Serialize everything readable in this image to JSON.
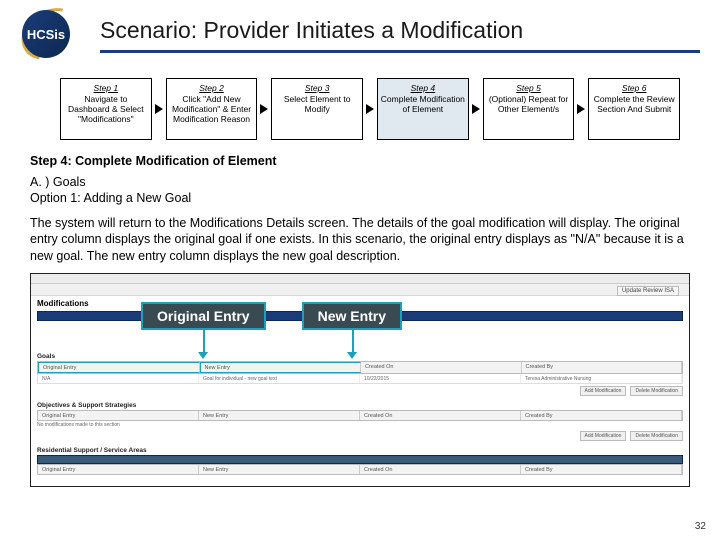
{
  "header": {
    "logo_text": "HCSis",
    "title": "Scenario: Provider Initiates a Modification"
  },
  "steps": [
    {
      "title": "Step 1",
      "text": "Navigate to Dashboard & Select \"Modifications\"",
      "active": false
    },
    {
      "title": "Step 2",
      "text": "Click \"Add New Modification\" & Enter Modification Reason",
      "active": false
    },
    {
      "title": "Step 3",
      "text": "Select Element to Modify",
      "active": false
    },
    {
      "title": "Step 4",
      "text": "Complete Modification of Element",
      "active": true
    },
    {
      "title": "Step 5",
      "text": "(Optional) Repeat for Other Element/s",
      "active": false
    },
    {
      "title": "Step 6",
      "text": "Complete the Review Section And Submit",
      "active": false
    }
  ],
  "content": {
    "emph": "Step 4: Complete Modification of Element",
    "section": "A. ) Goals",
    "option": "Option 1: Adding a New Goal",
    "paragraph": "The system will return to the Modifications Details screen. The details of the goal modification will display. The original entry column displays the original goal if one exists. In this scenario, the original entry displays as \"N/A\" because it is a new goal. The new entry column displays the new goal description."
  },
  "screenshot": {
    "heading": "Modifications",
    "callout1": "Original Entry",
    "callout2": "New Entry",
    "gridhead": {
      "c1": "Original Entry",
      "c2": "New Entry",
      "c3": "Created On",
      "c4": "Created By"
    },
    "row": {
      "c1": "N/A",
      "c2": "Goal for individual - new goal text",
      "c3": "10/22/2015",
      "c4": "Teresa Administrative Nursing"
    },
    "subhead1": "Goals",
    "subhead2": "Objectives & Support Strategies",
    "note2": "No modifications made to this section",
    "subhead3": "Residential Support / Service Areas",
    "btn_add_mod": "Add Modification",
    "btn_delete": "Delete Modification",
    "review_label": "Update Review ISA"
  },
  "page_number": "32"
}
